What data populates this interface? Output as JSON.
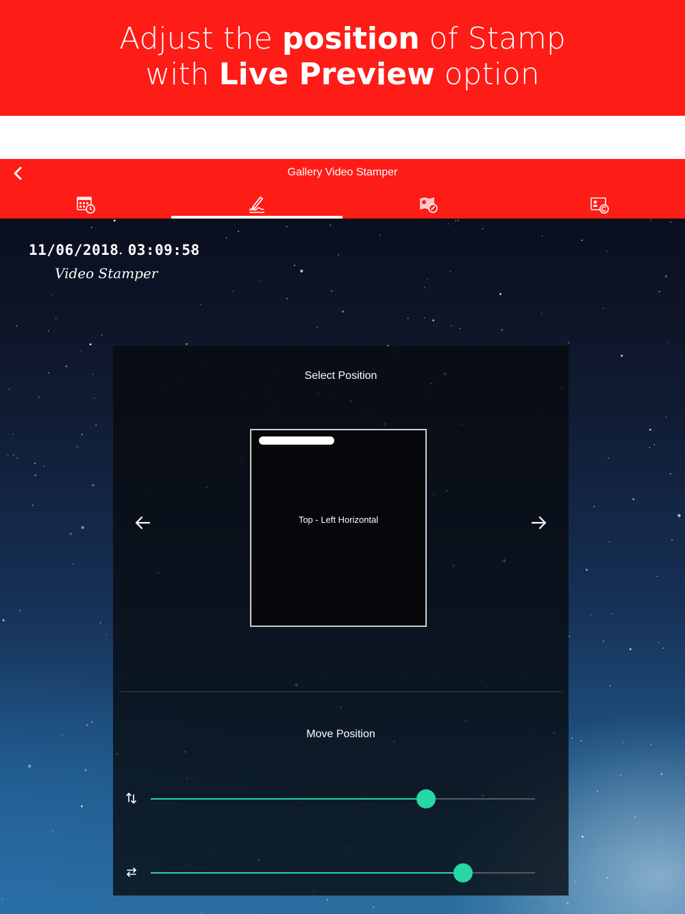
{
  "promo": {
    "line1_a": "Adjust the ",
    "line1_b": "position",
    "line1_c": " of Stamp",
    "line2_a": "with ",
    "line2_b": "Live Preview",
    "line2_c": " option"
  },
  "appbar": {
    "title": "Gallery Video Stamper",
    "back_icon": "chevron-left-icon",
    "tabs": [
      {
        "icon": "calendar-clock-icon",
        "active": false
      },
      {
        "icon": "signature-pen-icon",
        "active": true
      },
      {
        "icon": "map-location-icon",
        "active": false
      },
      {
        "icon": "contact-card-icon",
        "active": false
      }
    ]
  },
  "stamp": {
    "datetime": "11/06/2018 03:09:58",
    "text": "Video Stamper"
  },
  "panel": {
    "select_title": "Select Position",
    "preview_label": "Top - Left Horizontal",
    "prev_icon": "arrow-left-icon",
    "next_icon": "arrow-right-icon",
    "move_title": "Move Position",
    "vertical_slider": {
      "icon": "vertical-arrows-icon",
      "value": 0.716
    },
    "horizontal_slider": {
      "icon": "horizontal-arrows-icon",
      "value": 0.812
    }
  },
  "colors": {
    "brand_red": "#fe1c17",
    "slider_accent": "#26d8a6"
  }
}
